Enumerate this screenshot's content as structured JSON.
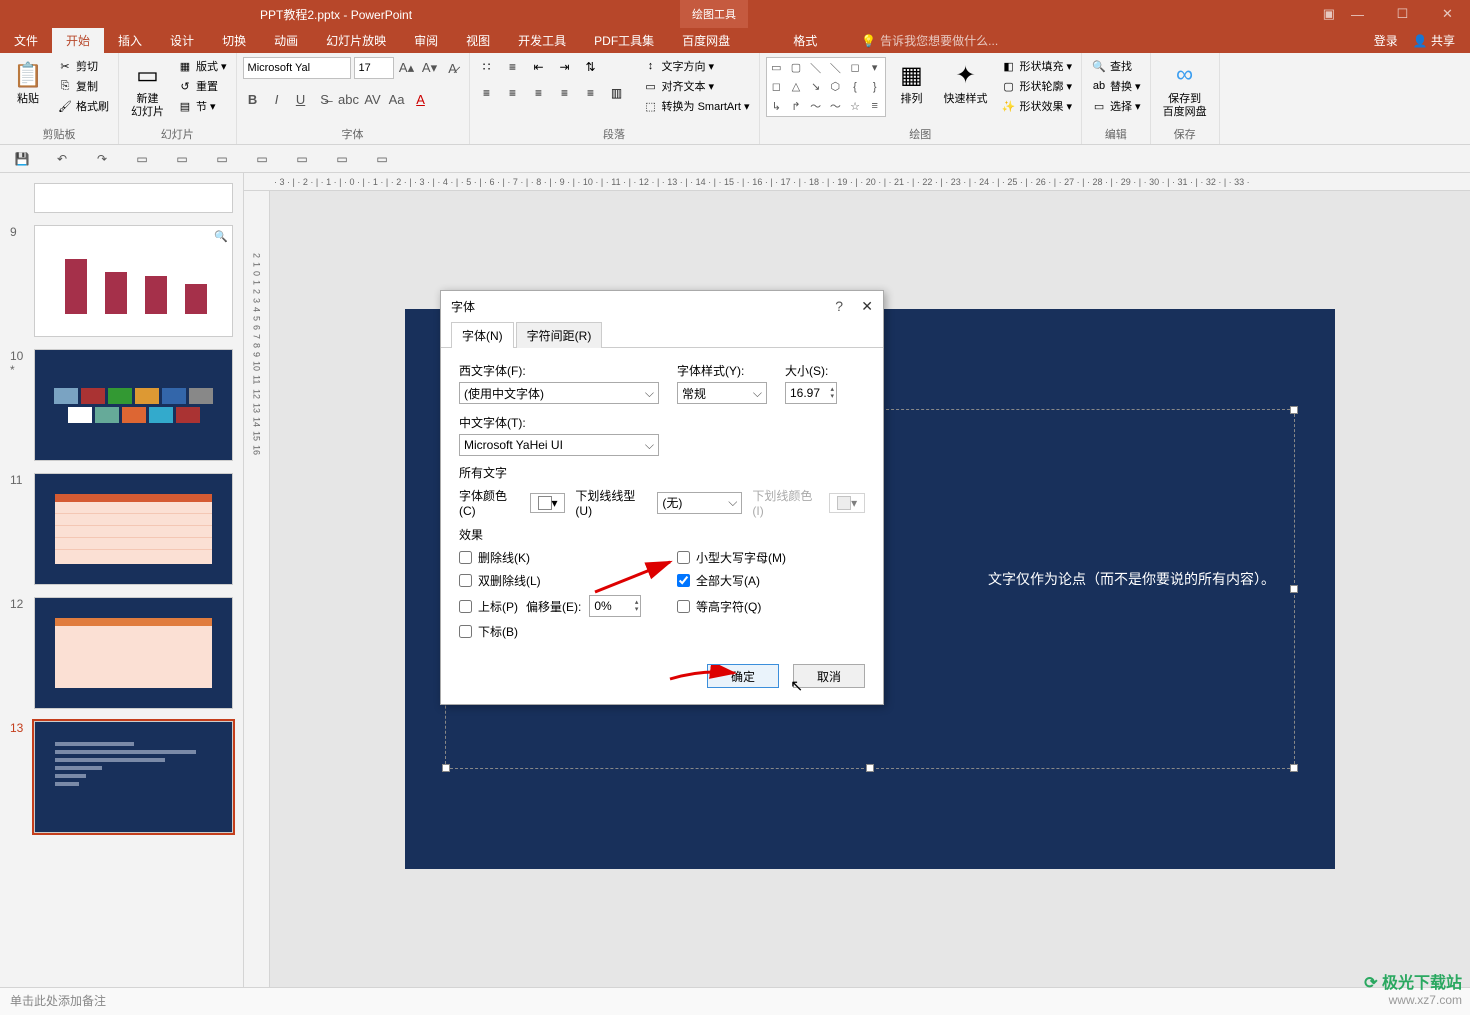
{
  "app": {
    "doc_title": "PPT教程2.pptx - PowerPoint",
    "drawing_tools": "绘图工具",
    "login": "登录",
    "share": "共享"
  },
  "tabs": {
    "file": "文件",
    "home": "开始",
    "insert": "插入",
    "design": "设计",
    "transitions": "切换",
    "animations": "动画",
    "slideshow": "幻灯片放映",
    "review": "审阅",
    "view": "视图",
    "developer": "开发工具",
    "pdf": "PDF工具集",
    "baidu": "百度网盘",
    "format": "格式",
    "tell_me": "告诉我您想要做什么..."
  },
  "ribbon": {
    "clipboard": {
      "label": "剪贴板",
      "paste": "粘贴",
      "cut": "剪切",
      "copy": "复制",
      "painter": "格式刷"
    },
    "slides": {
      "label": "幻灯片",
      "new_slide": "新建\n幻灯片",
      "layout": "版式",
      "reset": "重置",
      "section": "节"
    },
    "font": {
      "label": "字体",
      "name": "Microsoft Yal",
      "size": "17"
    },
    "paragraph": {
      "label": "段落",
      "text_dir": "文字方向",
      "align_text": "对齐文本",
      "smartart": "转换为 SmartArt"
    },
    "drawing": {
      "label": "绘图",
      "arrange": "排列",
      "quick_style": "快速样式",
      "shape_fill": "形状填充",
      "shape_outline": "形状轮廓",
      "shape_effects": "形状效果"
    },
    "editing": {
      "label": "编辑",
      "find": "查找",
      "replace": "替换",
      "select": "选择"
    },
    "save": {
      "label": "保存",
      "save_to": "保存到\n百度网盘"
    }
  },
  "slide": {
    "visible_text": "文字仅作为论点（而不是你要说的所有内容）。"
  },
  "thumbs": {
    "nums": [
      "9",
      "10",
      "11",
      "12",
      "13"
    ],
    "star_marker": "*"
  },
  "notes": {
    "placeholder": "单击此处添加备注"
  },
  "dialog": {
    "title": "字体",
    "tab_font": "字体(N)",
    "tab_spacing": "字符间距(R)",
    "latin_font_label": "西文字体(F):",
    "latin_font_value": "(使用中文字体)",
    "style_label": "字体样式(Y):",
    "style_value": "常规",
    "size_label": "大小(S):",
    "size_value": "16.97",
    "cjk_font_label": "中文字体(T):",
    "cjk_font_value": "Microsoft YaHei UI",
    "all_text": "所有文字",
    "font_color": "字体颜色(C)",
    "underline_style": "下划线线型(U)",
    "underline_value": "(无)",
    "underline_color": "下划线颜色(I)",
    "effects": "效果",
    "strike": "删除线(K)",
    "dbl_strike": "双删除线(L)",
    "superscript": "上标(P)",
    "offset_label": "偏移量(E):",
    "offset_value": "0%",
    "subscript": "下标(B)",
    "small_caps": "小型大写字母(M)",
    "all_caps": "全部大写(A)",
    "equal_height": "等高字符(Q)",
    "ok": "确定",
    "cancel": "取消"
  },
  "ruler": {
    "h": "· 3 · | · 2 · | · 1 · | · 0 · | · 1 · | · 2 · | · 3 · | · 4 · | · 5 · | · 6 · | · 7 · | · 8 · | · 9 · | · 10 · | · 11 · | · 12 · | · 13 · | · 14 · | · 15 · | · 16 · | · 17 · | · 18 · | · 19 · | · 20 · | · 21 · | · 22 · | · 23 · | · 24 · | · 25 · | · 26 · | · 27 · | · 28 · | · 29 · | · 30 · | · 31 · | · 32 · | · 33 ·"
  },
  "watermark": {
    "brand": "极光下载站",
    "url": "www.xz7.com"
  }
}
